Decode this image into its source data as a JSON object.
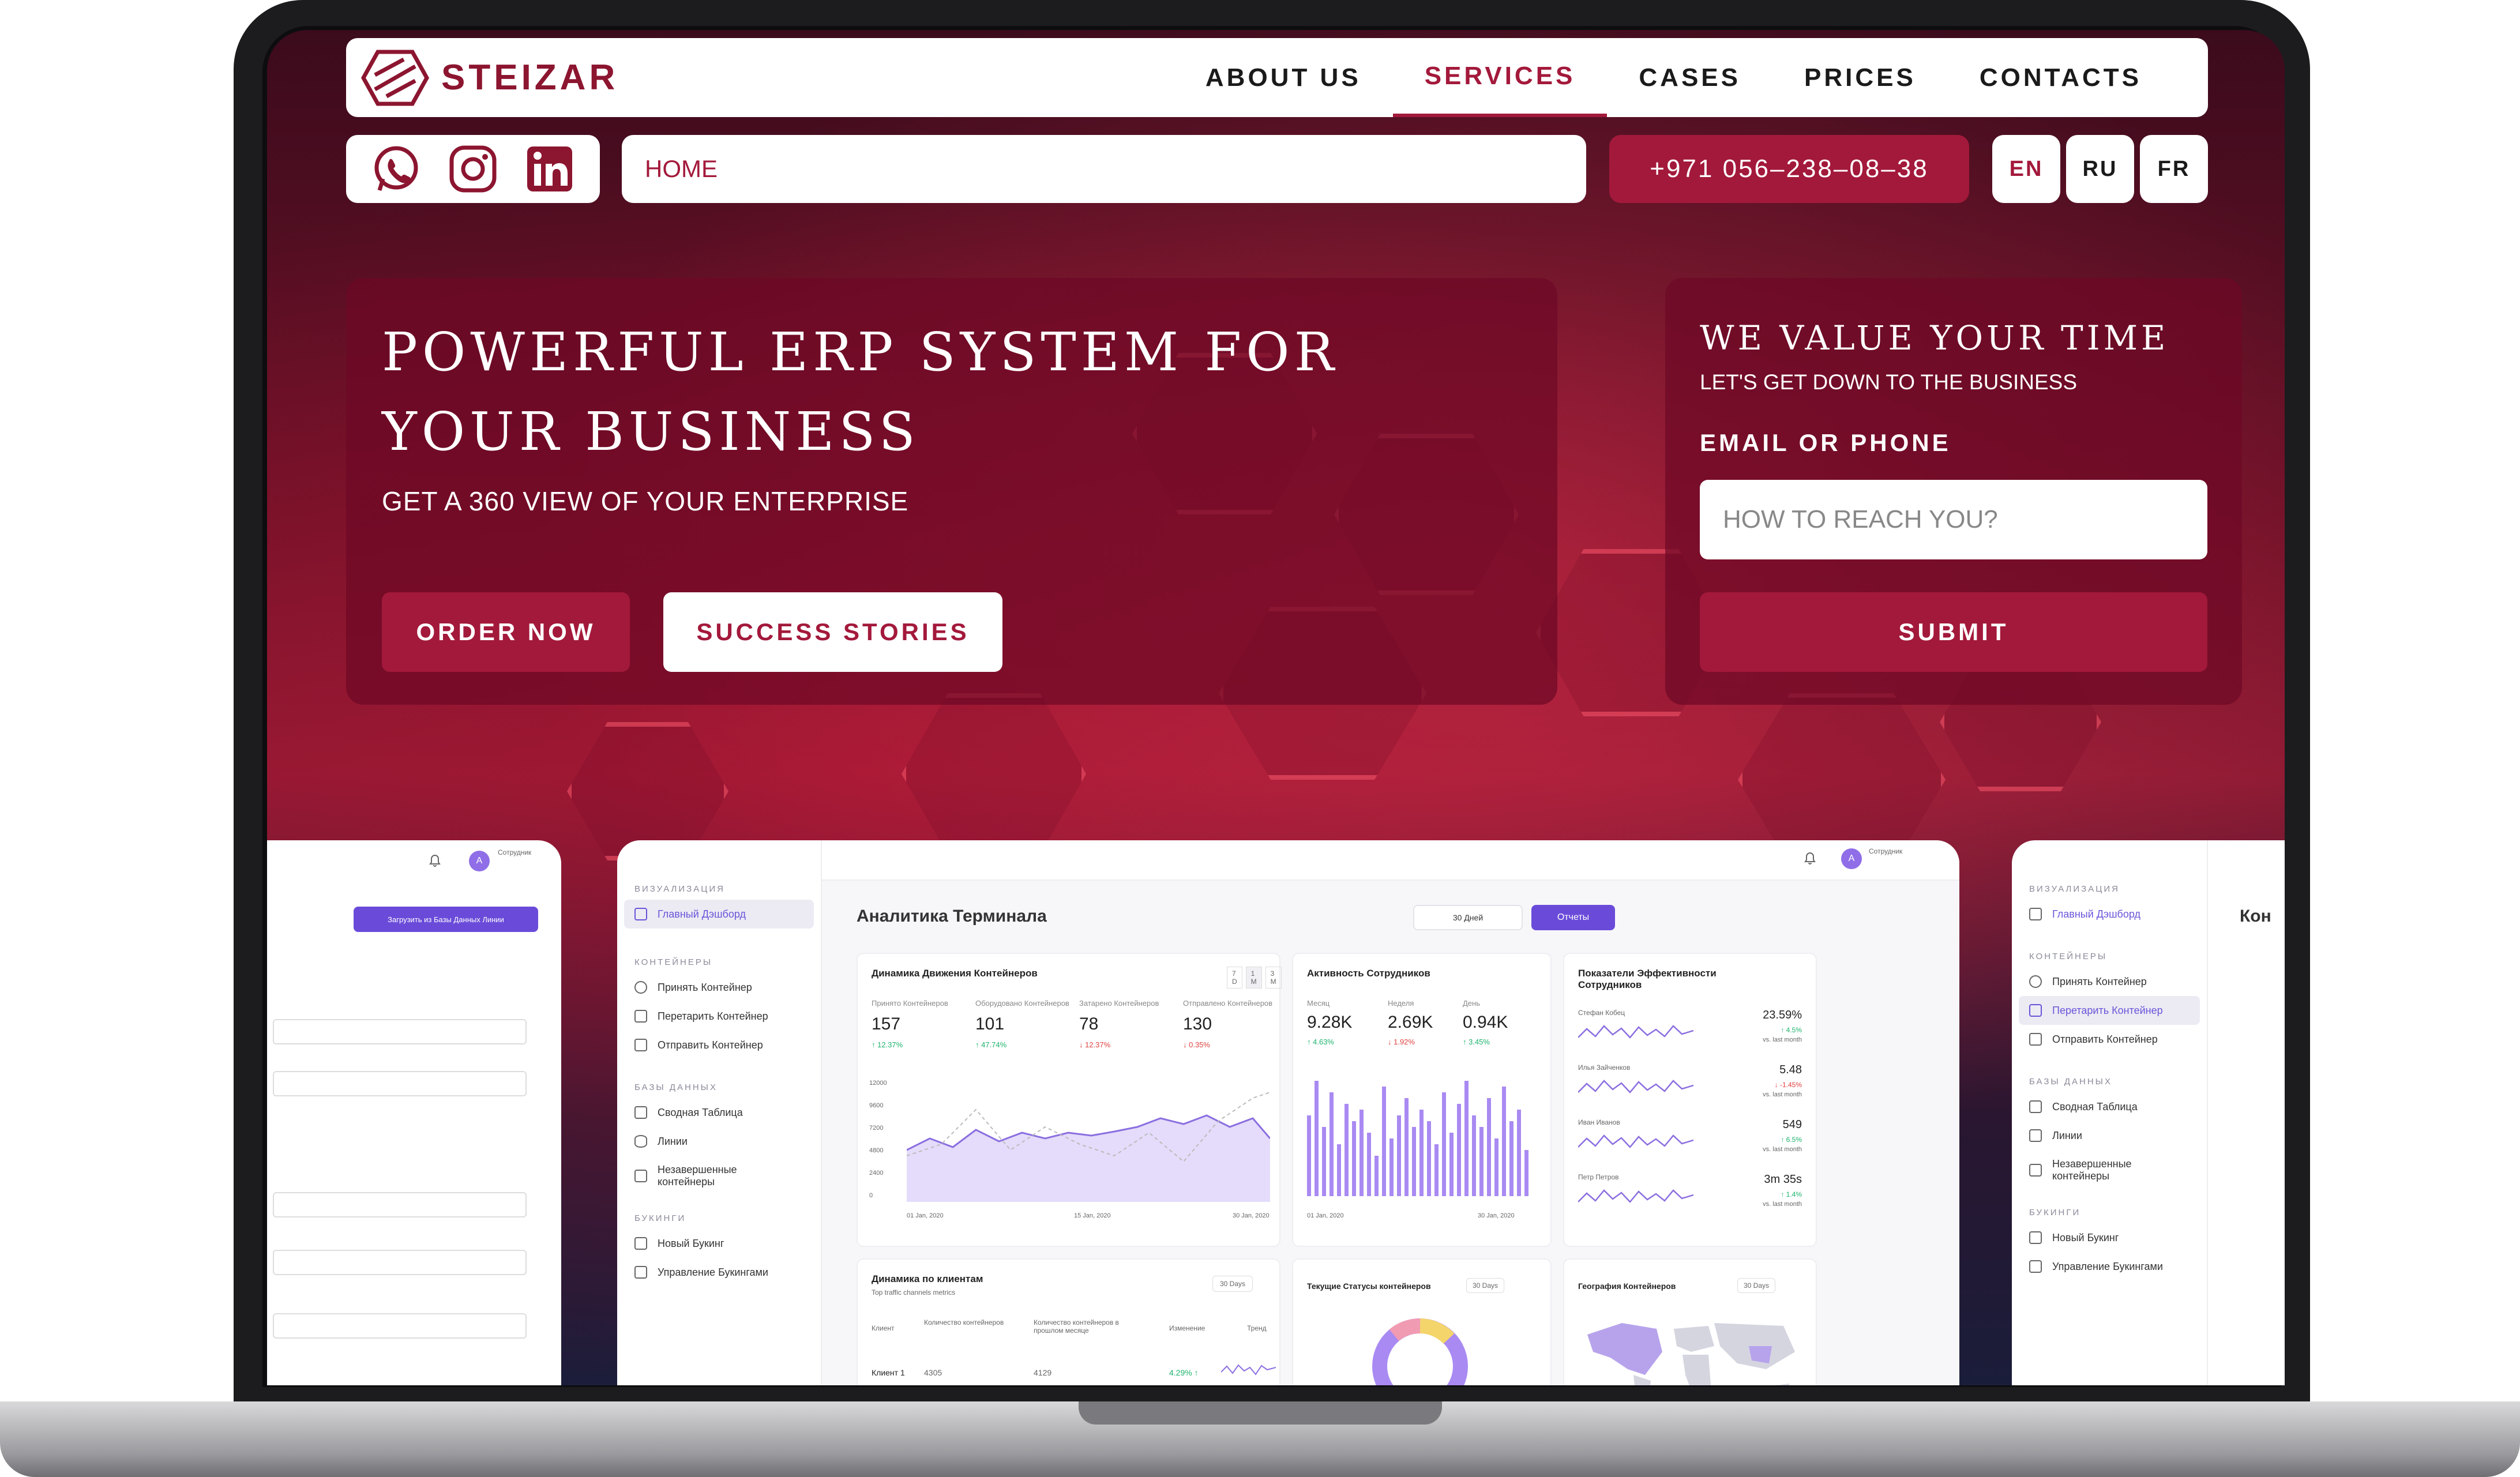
{
  "brand": {
    "name": "STEIZAR",
    "accent": "#a3193b"
  },
  "nav": {
    "items": [
      {
        "label": "ABOUT US",
        "active": false
      },
      {
        "label": "SERVICES",
        "active": true
      },
      {
        "label": "CASES",
        "active": false
      },
      {
        "label": "PRICES",
        "active": false
      },
      {
        "label": "CONTACTS",
        "active": false
      }
    ]
  },
  "socials": [
    "whatsapp-icon",
    "instagram-icon",
    "linkedin-icon"
  ],
  "breadcrumb": "HOME",
  "phone": "+971 056–238–08–38",
  "languages": [
    {
      "code": "EN",
      "active": true
    },
    {
      "code": "RU",
      "active": false
    },
    {
      "code": "FR",
      "active": false
    }
  ],
  "hero": {
    "title": "POWERFUL ERP SYSTEM FOR YOUR BUSINESS",
    "subtitle": "GET A 360 VIEW OF YOUR ENTERPRISE",
    "order_label": "ORDER NOW",
    "stories_label": "SUCCESS STORIES"
  },
  "form": {
    "title": "WE VALUE YOUR TIME",
    "subtitle": "LET'S GET DOWN TO THE BUSINESS",
    "label": "EMAIL OR PHONE",
    "placeholder": "HOW TO REACH YOU?",
    "submit_label": "SUBMIT"
  },
  "dashboard": {
    "title": "Аналитика Терминала",
    "period": "30 Дней",
    "reports": "Отчеты",
    "user_role": "Сотрудник",
    "avatar": "A",
    "upload_button": "Загрузить из Базы Данных Линии",
    "sidebar": [
      {
        "section": "ВИЗУАЛИЗАЦИЯ",
        "items": [
          "Главный Дэшборд"
        ]
      },
      {
        "section": "КОНТЕЙНЕРЫ",
        "items": [
          "Принять Контейнер",
          "Перетарить Контейнер",
          "Отправить Контейнер"
        ]
      },
      {
        "section": "БАЗЫ ДАННЫХ",
        "items": [
          "Сводная Таблица",
          "Линии",
          "Незавершенные контейнеры"
        ]
      },
      {
        "section": "БУКИНГИ",
        "items": [
          "Новый Букинг",
          "Управление Букингами"
        ]
      }
    ],
    "movement": {
      "title": "Динамика Движения Контейнеров",
      "ranges": [
        "7 D",
        "1 M",
        "3 M"
      ],
      "kpis": [
        {
          "label": "Принято Контейнеров",
          "value": "157",
          "change": "↑ 12.37%",
          "up": true
        },
        {
          "label": "Оборудовано Контейнеров",
          "value": "101",
          "change": "↑ 47.74%",
          "up": true
        },
        {
          "label": "Затарено Контейнеров",
          "value": "78",
          "change": "↓ 12.37%",
          "up": false
        },
        {
          "label": "Отправлено Контейнеров",
          "value": "130",
          "change": "↓ 0.35%",
          "up": false
        }
      ],
      "y_ticks": [
        "12000",
        "9600",
        "7200",
        "4800",
        "2400",
        "0"
      ],
      "x_ticks": [
        "01 Jan, 2020",
        "15 Jan, 2020",
        "30 Jan, 2020"
      ]
    },
    "activity": {
      "title": "Активность Сотрудников",
      "kpis": [
        {
          "label": "Месяц",
          "value": "9.28K",
          "change": "↑ 4.63%",
          "up": true
        },
        {
          "label": "Неделя",
          "value": "2.69K",
          "change": "↓ 1.92%",
          "up": false
        },
        {
          "label": "День",
          "value": "0.94K",
          "change": "↑ 3.45%",
          "up": true
        }
      ],
      "x_ticks": [
        "01 Jan, 2020",
        "30 Jan, 2020"
      ]
    },
    "efficiency": {
      "title": "Показатели Эффективности Сотрудников",
      "rows": [
        {
          "name": "Стефан Кобец",
          "value": "23.59%",
          "change": "↑ 4.5%",
          "up": true,
          "note": "vs. last month"
        },
        {
          "name": "Илья Зайченков",
          "value": "5.48",
          "change": "↓ -1.45%",
          "up": false,
          "note": "vs. last month"
        },
        {
          "name": "Иван Иванов",
          "value": "549",
          "change": "↑ 6.5%",
          "up": true,
          "note": "vs. last month"
        },
        {
          "name": "Петр Петров",
          "value": "3m 35s",
          "change": "↑ 1.4%",
          "up": true,
          "note": "vs. last month"
        }
      ]
    },
    "clients": {
      "title": "Динамика по клиентам",
      "subtitle": "Top traffic channels metrics",
      "period": "30 Days",
      "columns": [
        "Клиент",
        "Количество контейнеров",
        "Количество контейнеров в прошлом месяце",
        "Изменение",
        "Тренд"
      ],
      "rows": [
        [
          "Клиент 1",
          "4305",
          "4129",
          "4.29% ↑"
        ]
      ]
    },
    "statuses": {
      "title": "Текущие Статусы контейнеров",
      "period": "30 Days"
    },
    "geo": {
      "title": "География Контейнеров",
      "period": "30 Days"
    },
    "right_title": "Кон"
  }
}
